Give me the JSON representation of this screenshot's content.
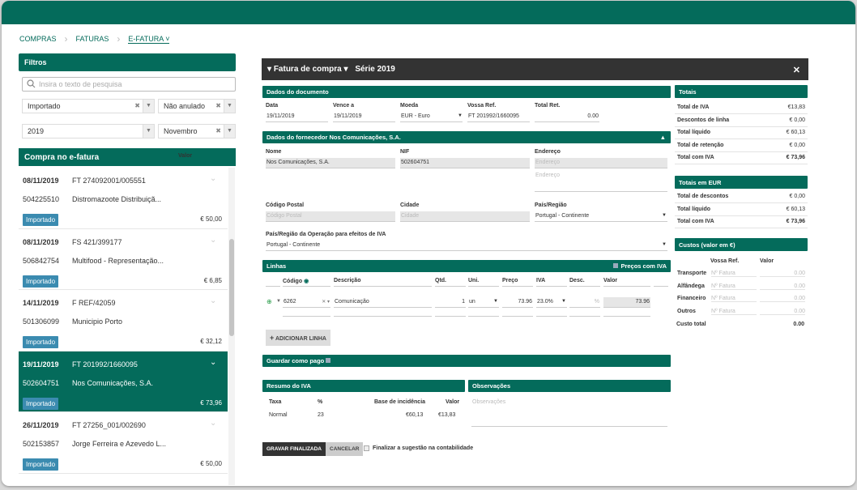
{
  "breadcrumb": {
    "items": [
      "COMPRAS",
      "FATURAS",
      "E-FATURA"
    ]
  },
  "filters": {
    "title": "Filtros",
    "search_placeholder": "Insira o texto de pesquisa",
    "f1": "Importado",
    "f2": "Não anulado",
    "f3": "2019",
    "f4": "Novembro"
  },
  "list": {
    "col1": "Compra no e-fatura",
    "col2": "Valor",
    "items": [
      {
        "date": "08/11/2019",
        "num": "FT 274092001/005551",
        "nif": "504225510",
        "name": "Distromazoote Distribuiçã...",
        "badge": "Importado",
        "amount": "€ 50,00"
      },
      {
        "date": "08/11/2019",
        "num": "FS 421/399177",
        "nif": "506842754",
        "name": "Multifood - Representação...",
        "badge": "Importado",
        "amount": "€ 6,85"
      },
      {
        "date": "14/11/2019",
        "num": "F REF/42059",
        "nif": "501306099",
        "name": "Municipio Porto",
        "badge": "Importado",
        "amount": "€ 32,12"
      },
      {
        "date": "19/11/2019",
        "num": "FT 201992/1660095",
        "nif": "502604751",
        "name": "Nos Comunicações, S.A.",
        "badge": "Importado",
        "amount": "€ 73,96"
      },
      {
        "date": "26/11/2019",
        "num": "FT 27256_001/002690",
        "nif": "502153857",
        "name": "Jorge Ferreira e Azevedo L...",
        "badge": "Importado",
        "amount": "€ 50,00"
      }
    ]
  },
  "header": {
    "type": "Fatura de compra",
    "series": "Série 2019"
  },
  "doc": {
    "title": "Dados do documento",
    "data_label": "Data",
    "data": "19/11/2019",
    "vence_label": "Vence a",
    "vence": "19/11/2019",
    "moeda_label": "Moeda",
    "moeda": "EUR - Euro",
    "ref_label": "Vossa Ref.",
    "ref": "FT 201992/1660095",
    "ret_label": "Total Ret.",
    "ret": "0.00"
  },
  "supplier": {
    "title": "Dados do fornecedor Nos Comunicações, S.A.",
    "nome_label": "Nome",
    "nome": "Nos Comunicações, S.A.",
    "nif_label": "NIF",
    "nif": "502604751",
    "end_label": "Endereço",
    "end_ph1": "Endereço",
    "end_ph2": "Endereço",
    "cp_label": "Código Postal",
    "cp_ph": "Código Postal",
    "cidade_label": "Cidade",
    "cidade_ph": "Cidade",
    "pais_label": "País/Região",
    "pais": "Portugal - Continente",
    "pais_op_label": "País/Região da Operação para efeitos de IVA",
    "pais_op": "Portugal - Continente"
  },
  "lines": {
    "title": "Linhas",
    "precos_iva": "Preços com IVA",
    "h_codigo": "Código",
    "h_desc": "Descrição",
    "h_qtd": "Qtd.",
    "h_uni": "Uni.",
    "h_preco": "Preço",
    "h_iva": "IVA",
    "h_desc2": "Desc.",
    "h_valor": "Valor",
    "codigo": "6262",
    "descricao": "Comunicação",
    "qtd": "1",
    "uni": "un",
    "preco": "73.96",
    "iva": "23.0%",
    "desc": "%",
    "valor": "73.96",
    "add_label": "ADICIONAR LINHA"
  },
  "guardar": "Guardar como pago",
  "resumo": {
    "title": "Resumo do IVA",
    "h_taxa": "Taxa",
    "h_pct": "%",
    "h_base": "Base de incidência",
    "h_valor": "Valor",
    "taxa": "Normal",
    "pct": "23",
    "base": "€60,13",
    "valor": "€13,83"
  },
  "obs": {
    "title": "Observações",
    "ph": "Observações"
  },
  "actions": {
    "gravar": "GRAVAR FINALIZADA",
    "cancelar": "CANCELAR",
    "finalizar": "Finalizar a sugestão na contabilidade"
  },
  "totais": {
    "title": "Totais",
    "rows": [
      {
        "label": "Total de IVA",
        "value": "€13,83"
      },
      {
        "label": "Descontos de linha",
        "value": "€ 0,00"
      },
      {
        "label": "Total líquido",
        "value": "€ 60,13"
      },
      {
        "label": "Total de retenção",
        "value": "€ 0,00"
      },
      {
        "label": "Total com IVA",
        "value": "€ 73,96"
      }
    ]
  },
  "totais_eur": {
    "title": "Totais em EUR",
    "rows": [
      {
        "label": "Total de descontos",
        "value": "€ 0,00"
      },
      {
        "label": "Total líquido",
        "value": "€ 60,13"
      },
      {
        "label": "Total com IVA",
        "value": "€ 73,96"
      }
    ]
  },
  "custos": {
    "title": "Custos (valor em €)",
    "h_ref": "Vossa Ref.",
    "h_valor": "Valor",
    "rows": [
      {
        "label": "Transporte",
        "ph": "Nº Fatura",
        "value": "0.00"
      },
      {
        "label": "Alfândega",
        "ph": "Nº Fatura",
        "value": "0.00"
      },
      {
        "label": "Financeiro",
        "ph": "Nº Fatura",
        "value": "0.00"
      },
      {
        "label": "Outros",
        "ph": "Nº Fatura",
        "value": "0.00"
      }
    ],
    "total_label": "Custo total",
    "total": "0.00"
  }
}
